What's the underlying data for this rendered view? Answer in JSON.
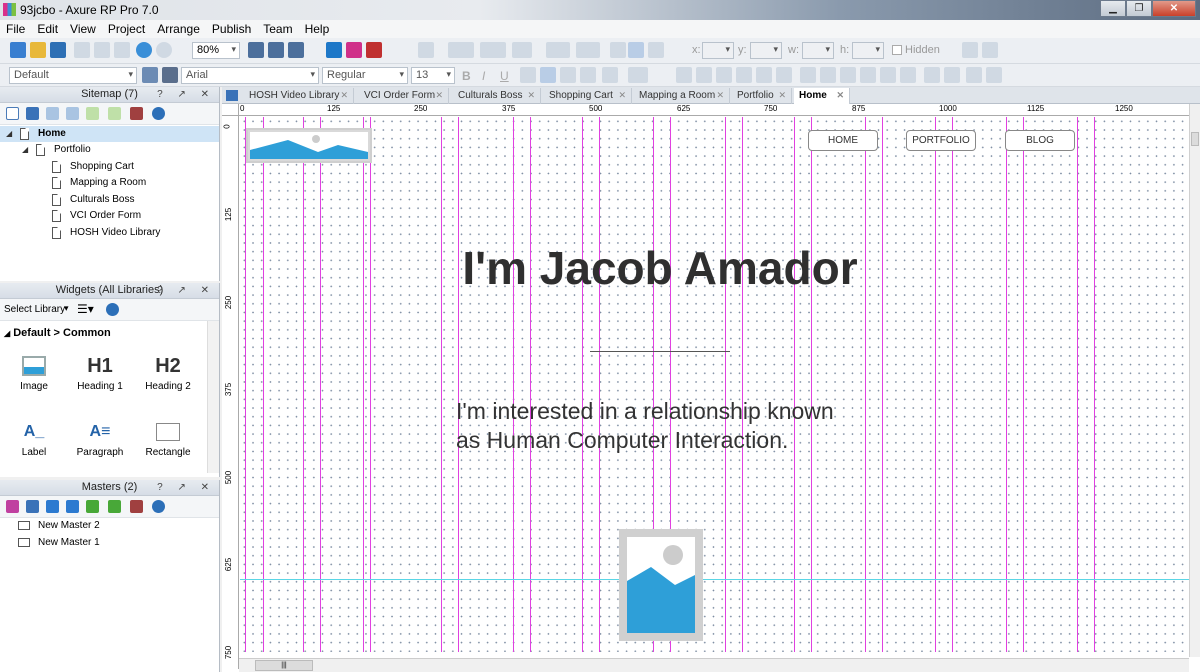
{
  "window": {
    "title": "93jcbo - Axure RP Pro 7.0",
    "minimize": "▁",
    "maximize": "❐",
    "close": "✕"
  },
  "menu": [
    "File",
    "Edit",
    "View",
    "Project",
    "Arrange",
    "Publish",
    "Team",
    "Help"
  ],
  "toolbar": {
    "zoom": "80%",
    "style": "Default",
    "font": "Arial",
    "weight": "Regular",
    "size": "13",
    "x_label": "x:",
    "y_label": "y:",
    "w_label": "w:",
    "h_label": "h:",
    "hidden_label": "Hidden"
  },
  "sitemap": {
    "title": "Sitemap (7)",
    "controls": "? ↗ ✕",
    "items": [
      "Home",
      "Portfolio",
      "Shopping Cart",
      "Mapping a Room",
      "Culturals Boss",
      "VCI Order Form",
      "HOSH Video Library"
    ]
  },
  "widgets": {
    "title": "Widgets (All Libraries)",
    "controls": "? ↗ ✕",
    "select_library": "Select Library",
    "group": "Default > Common",
    "items": [
      {
        "label": "Image",
        "glyph": "▲"
      },
      {
        "label": "Heading 1",
        "glyph": "H1"
      },
      {
        "label": "Heading 2",
        "glyph": "H2"
      },
      {
        "label": "Label",
        "glyph": "A_"
      },
      {
        "label": "Paragraph",
        "glyph": "A≡"
      },
      {
        "label": "Rectangle",
        "glyph": ""
      }
    ]
  },
  "masters": {
    "title": "Masters (2)",
    "controls": "? ↗ ✕",
    "items": [
      "New Master 2",
      "New Master 1"
    ]
  },
  "tabs": [
    "HOSH Video Library",
    "VCI Order Form",
    "Culturals Boss",
    "Shopping Cart",
    "Mapping a Room",
    "Portfolio",
    "Home"
  ],
  "ruler": {
    "h": [
      "0",
      "125",
      "250",
      "375",
      "500",
      "625",
      "750",
      "875",
      "1000",
      "1125",
      "1250"
    ],
    "v": [
      "0",
      "125",
      "250",
      "375",
      "500",
      "625",
      "750"
    ]
  },
  "page": {
    "nav": [
      "HOME",
      "PORTFOLIO",
      "BLOG"
    ],
    "heading": "I'm Jacob Amador",
    "para_line1": "I'm interested in a relationship known",
    "para_line2": "as Human Computer Interaction."
  },
  "colors": {
    "guide": "#e040e0",
    "accent": "#2e9fd8",
    "selection": "#cfe4f6"
  }
}
